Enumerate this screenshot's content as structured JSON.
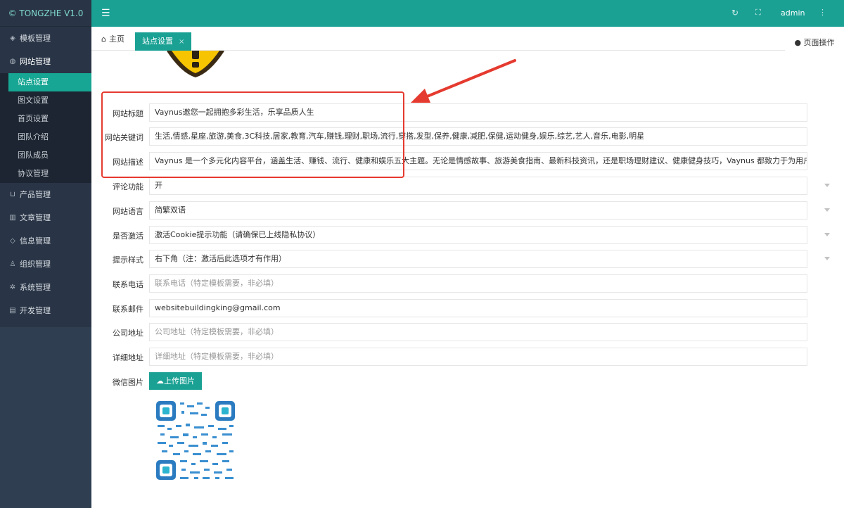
{
  "app": {
    "logo": "© TONGZHE V1.0"
  },
  "header": {
    "user": "admin"
  },
  "sidebar": {
    "items": [
      {
        "label": "模板管理",
        "icon": "layers-icon"
      },
      {
        "label": "网站管理",
        "icon": "globe-icon",
        "open": true,
        "children": [
          "站点设置",
          "图文设置",
          "首页设置",
          "团队介绍",
          "团队成员",
          "协议管理"
        ],
        "active_child": "站点设置"
      },
      {
        "label": "产品管理",
        "icon": "cart-icon"
      },
      {
        "label": "文章管理",
        "icon": "book-icon"
      },
      {
        "label": "信息管理",
        "icon": "tag-icon"
      },
      {
        "label": "组织管理",
        "icon": "user-icon"
      },
      {
        "label": "系统管理",
        "icon": "gear-icon"
      },
      {
        "label": "开发管理",
        "icon": "code-icon"
      }
    ]
  },
  "tabs": {
    "home": "主页",
    "active": "站点设置",
    "close": "×",
    "page_ops": "页面操作"
  },
  "form": {
    "site_title": {
      "label": "网站标题",
      "value": "Vaynus邀您一起拥抱多彩生活，乐享品质人生"
    },
    "site_keywords": {
      "label": "网站关键词",
      "value": "生活,情感,星座,旅游,美食,3C科技,居家,教育,汽车,赚钱,理财,职场,流行,穿搭,发型,保养,健康,减肥,保健,运动健身,娱乐,综艺,艺人,音乐,电影,明星"
    },
    "site_desc": {
      "label": "网站描述",
      "value": "Vaynus 是一个多元化内容平台，涵盖生活、赚钱、流行、健康和娱乐五大主题。无论是情感故事、旅游美食指南、最新科技资讯，还是职场理财建议、健康健身技巧，Vaynus 都致力于为用户提供丰富的内容和实用的生活建议，引"
    },
    "comment": {
      "label": "评论功能",
      "value": "开"
    },
    "language": {
      "label": "网站语言",
      "value": "简繁双语"
    },
    "activate": {
      "label": "是否激活",
      "value": "激活Cookie提示功能（请确保已上线隐私协议）"
    },
    "prompt_style": {
      "label": "提示样式",
      "value": "右下角（注：激活后此选项才有作用）"
    },
    "phone": {
      "label": "联系电话",
      "value": "",
      "placeholder": "联系电话（特定模板需要，非必填）"
    },
    "email": {
      "label": "联系邮件",
      "value": "websitebuildingking@gmail.com"
    },
    "company_addr": {
      "label": "公司地址",
      "value": "",
      "placeholder": "公司地址（特定模板需要，非必填）"
    },
    "detail_addr": {
      "label": "详细地址",
      "value": "",
      "placeholder": "详细地址（特定模板需要，非必填）"
    },
    "wechat": {
      "label": "微信图片",
      "upload_label": "上传图片"
    }
  },
  "colors": {
    "accent": "#1aa194",
    "sidebar": "#293546",
    "highlight": "#e53a2f"
  }
}
